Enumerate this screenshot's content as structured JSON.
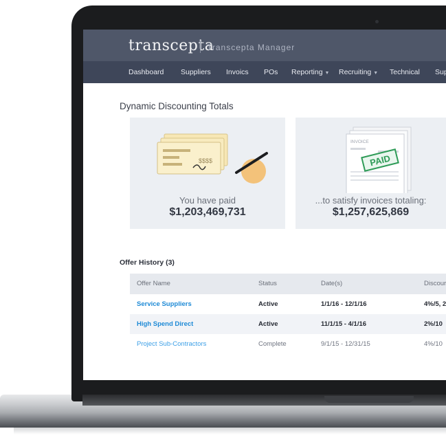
{
  "app": {
    "logo": "transcepta",
    "name": "Transcepta Manager"
  },
  "nav": [
    {
      "label": "Dashboard",
      "dropdown": false
    },
    {
      "label": "Suppliers",
      "dropdown": false
    },
    {
      "label": "Invoics",
      "dropdown": false
    },
    {
      "label": "POs",
      "dropdown": false
    },
    {
      "label": "Reporting",
      "dropdown": true
    },
    {
      "label": "Recruiting",
      "dropdown": true
    },
    {
      "label": "Technical",
      "dropdown": false
    },
    {
      "label": "Sup",
      "dropdown": false
    }
  ],
  "page_title": "Dynamic Discounting Totals",
  "summary": {
    "paid_label": "You have paid",
    "paid_value": "$1,203,469,731",
    "invoices_label": "...to satisfy invoices totaling:",
    "invoices_value": "$1,257,625,869",
    "check_amount_text": "$$$$",
    "invoice_doc_title": "INVOICE",
    "stamp_text": "PAID"
  },
  "offer_history": {
    "title": "Offer History (3)",
    "columns": [
      "Offer Name",
      "Status",
      "Date(s)",
      "Discour"
    ],
    "rows": [
      {
        "name": "Service Suppliers",
        "status": "Active",
        "dates": "1/1/16 - 12/1/16",
        "discount": "4%/5, 2"
      },
      {
        "name": "High Spend Direct",
        "status": "Active",
        "dates": "11/1/15 - 4/1/16",
        "discount": "2%/10"
      },
      {
        "name": "Project Sub-Contractors",
        "status": "Complete",
        "dates": "9/1/15 - 12/31/15",
        "discount": "4%/10"
      }
    ]
  },
  "colors": {
    "brand_bar": "#4f5769",
    "nav_bar": "#3e4659",
    "link": "#1e8ad6",
    "card_bg": "#eceff3",
    "stamp": "#2e9b57"
  }
}
